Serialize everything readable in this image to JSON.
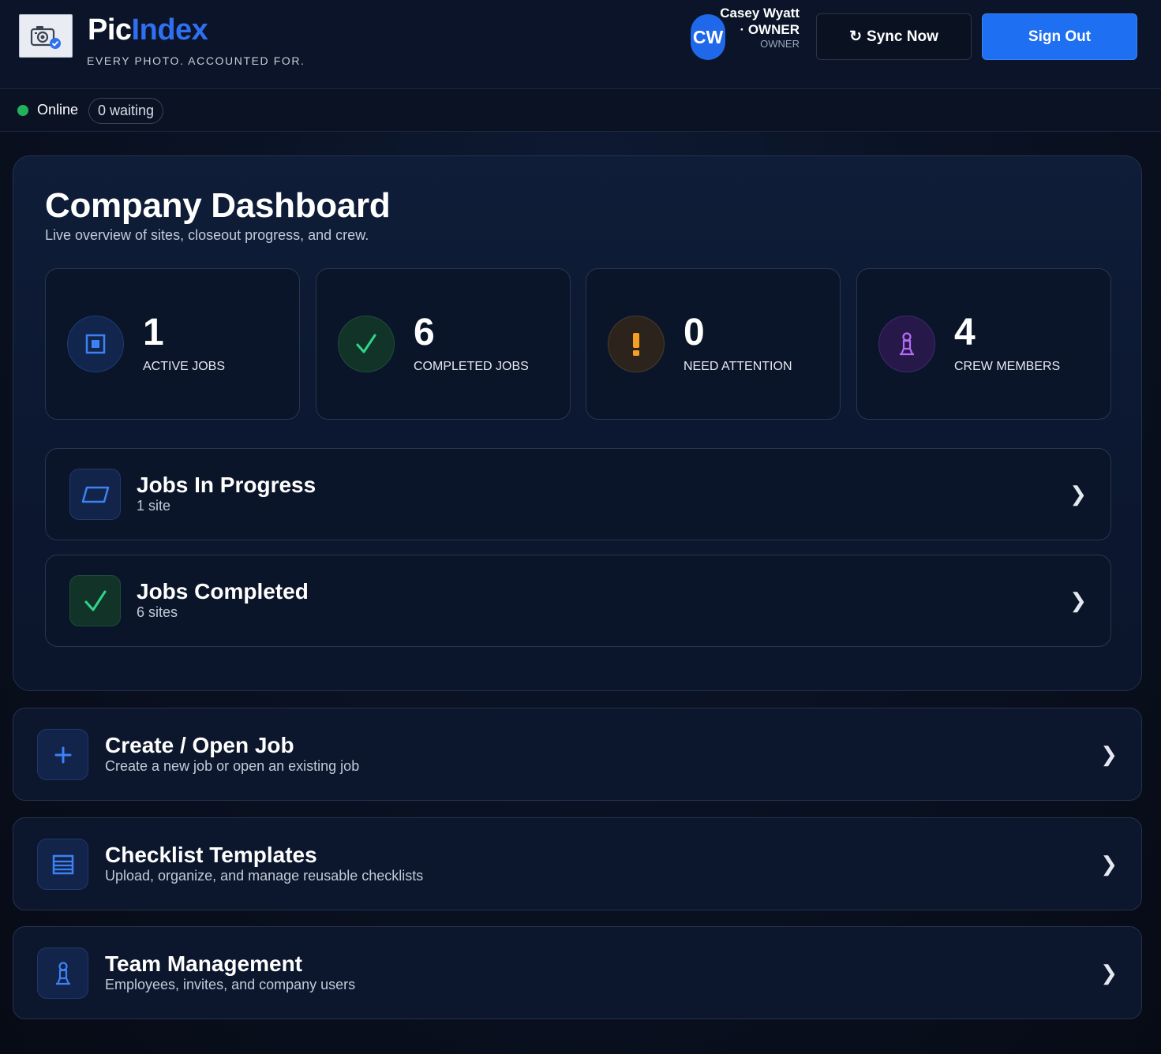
{
  "app": {
    "brand_part1": "Pic",
    "brand_part2": "Index",
    "tagline": "EVERY PHOTO. ACCOUNTED FOR.",
    "accent_color": "#1f6ff2"
  },
  "user": {
    "initials": "CW",
    "name": "Casey Wyatt · OWNER",
    "role": "OWNER"
  },
  "header_actions": {
    "sync_icon": "↻",
    "sync_label": "Sync Now",
    "signout_label": "Sign Out"
  },
  "status": {
    "online_label": "Online",
    "waiting_label": "0 waiting",
    "online_color": "#22b35a"
  },
  "dashboard": {
    "title": "Company Dashboard",
    "subtitle": "Live overview of sites, closeout progress, and crew.",
    "stats": [
      {
        "value": "1",
        "label": "ACTIVE JOBS",
        "icon": "active-jobs-icon"
      },
      {
        "value": "6",
        "label": "COMPLETED JOBS",
        "icon": "check-icon"
      },
      {
        "value": "0",
        "label": "NEED ATTENTION",
        "icon": "warning-icon"
      },
      {
        "value": "4",
        "label": "CREW MEMBERS",
        "icon": "crew-icon"
      }
    ],
    "rows": [
      {
        "title": "Jobs In Progress",
        "subtitle": "1 site",
        "chevron": "❯"
      },
      {
        "title": "Jobs Completed",
        "subtitle": "6 sites",
        "chevron": "❯"
      }
    ]
  },
  "nav": [
    {
      "title": "Create / Open Job",
      "subtitle": "Create a new job or open an existing job",
      "icon": "plus-icon",
      "chevron": "❯"
    },
    {
      "title": "Checklist Templates",
      "subtitle": "Upload, organize, and manage reusable checklists",
      "icon": "checklist-icon",
      "chevron": "❯"
    },
    {
      "title": "Team Management",
      "subtitle": "Employees, invites, and company users",
      "icon": "team-icon",
      "chevron": "❯"
    }
  ]
}
